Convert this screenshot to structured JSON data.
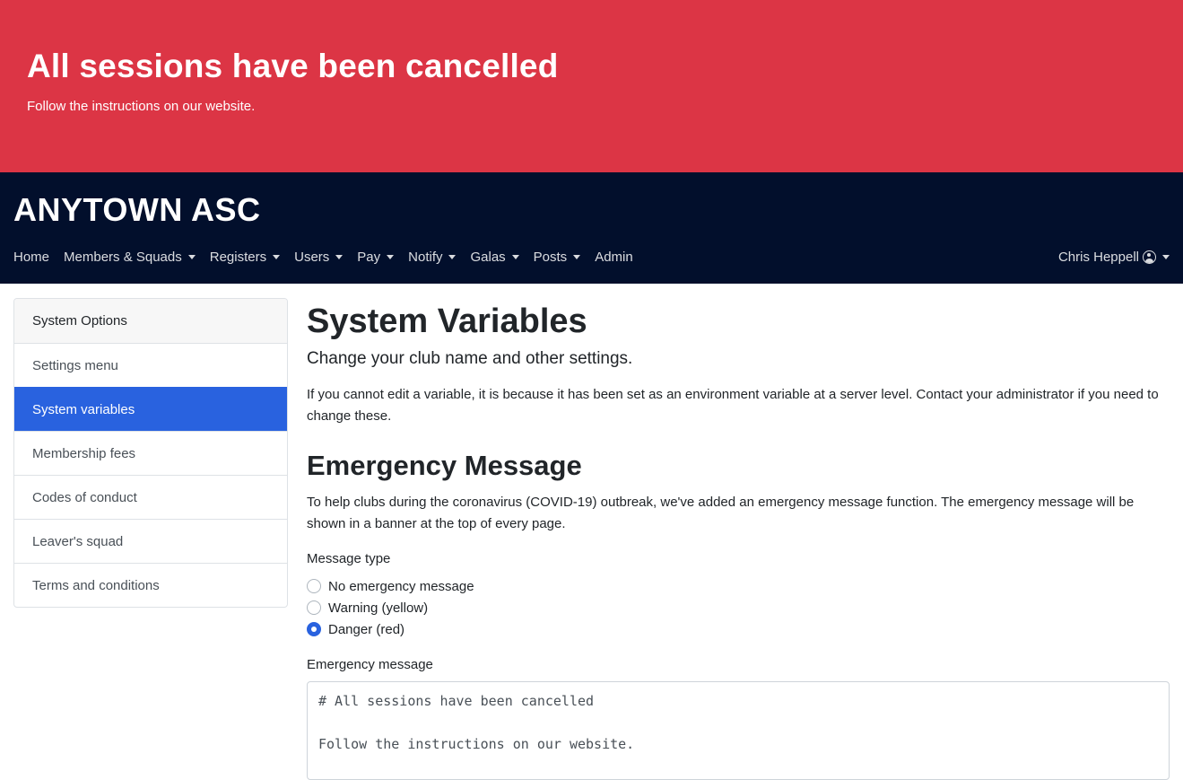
{
  "banner": {
    "title": "All sessions have been cancelled",
    "message": "Follow the instructions on our website."
  },
  "navbar": {
    "brand": "ANYTOWN ASC",
    "items": [
      {
        "label": "Home",
        "dropdown": false
      },
      {
        "label": "Members & Squads",
        "dropdown": true
      },
      {
        "label": "Registers",
        "dropdown": true
      },
      {
        "label": "Users",
        "dropdown": true
      },
      {
        "label": "Pay",
        "dropdown": true
      },
      {
        "label": "Notify",
        "dropdown": true
      },
      {
        "label": "Galas",
        "dropdown": true
      },
      {
        "label": "Posts",
        "dropdown": true
      },
      {
        "label": "Admin",
        "dropdown": false
      }
    ],
    "user": "Chris Heppell",
    "user_icon": "user-circle-icon"
  },
  "sidebar": {
    "header": "System Options",
    "items": [
      {
        "label": "Settings menu"
      },
      {
        "label": "System variables",
        "active": true
      },
      {
        "label": "Membership fees"
      },
      {
        "label": "Codes of conduct"
      },
      {
        "label": "Leaver's squad"
      },
      {
        "label": "Terms and conditions"
      }
    ],
    "active_color": "#2962df"
  },
  "main": {
    "title": "System Variables",
    "lead": "Change your club name and other settings.",
    "note": "If you cannot edit a variable, it is because it has been set as an environment variable at a server level. Contact your administrator if you need to change these.",
    "emergency": {
      "heading": "Emergency Message",
      "description": "To help clubs during the coronavirus (COVID-19) outbreak, we've added an emergency message function. The emergency message will be shown in a banner at the top of every page.",
      "type_label": "Message type",
      "options": [
        {
          "label": "No emergency message",
          "checked": false
        },
        {
          "label": "Warning (yellow)",
          "checked": false
        },
        {
          "label": "Danger (red)",
          "checked": true
        }
      ],
      "message_label": "Emergency message",
      "message_value": "# All sessions have been cancelled\n\nFollow the instructions on our website."
    }
  },
  "colors": {
    "banner_danger": "#dc3545",
    "navbar_bg": "#020f2c",
    "accent": "#2962df"
  }
}
